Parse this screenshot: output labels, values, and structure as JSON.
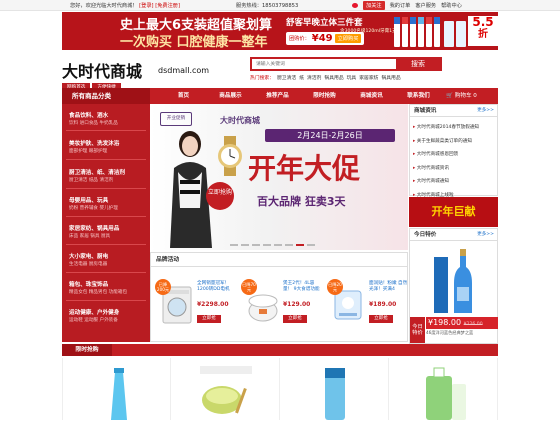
{
  "topbar": {
    "welcome": "您好，欢迎光临大时代商城！",
    "login": "[登录]",
    "register": "[免费注册]",
    "hotline_label": "服务热线：",
    "hotline": "18503798853",
    "weibo": "加关注",
    "links": [
      "我的订单",
      "客户服务",
      "帮助中心"
    ]
  },
  "banner": {
    "line1": "史上最大6支装超值聚划算",
    "line2": "一次购买 口腔健康一整年",
    "right_title": "舒客早晚立体三件套",
    "right_sub": "含3000名级120ml牙膏1支",
    "group_label": "团购价：",
    "group_price": "¥49",
    "group_btn": "立即购买",
    "discount_num": "5.5",
    "discount_unit": "折"
  },
  "logo": {
    "title": "大时代商城",
    "tags": [
      "网购首选",
      "方便快捷"
    ],
    "domain": "dsdmall.com"
  },
  "search": {
    "placeholder": "请输入关键词",
    "button": "搜索",
    "hot_label": "热门搜索：",
    "hot": [
      "厨卫清洁",
      "纸",
      "清洁剂",
      "锅具用品",
      "玩具",
      "家居家纺",
      "锅具用品"
    ]
  },
  "nav": {
    "all_categories": "所有商品分类",
    "items": [
      "首页",
      "商品展示",
      "推荐产品",
      "限时抢购",
      "商城资讯",
      "联系我们"
    ],
    "cart": "购物车 0"
  },
  "sidebar": [
    {
      "title": "食品饮料、酒水",
      "sub": "饮料  进口食品  牛奶乳品"
    },
    {
      "title": "美妆护肤、洗发沐浴",
      "sub": "面部护理  眼部护理"
    },
    {
      "title": "厨卫清洁、纸、清洁剂",
      "sub": "厨卫清洁  纸品  清洁剂"
    },
    {
      "title": "母婴用品、玩具",
      "sub": "奶粉  营养辅食  婴儿护理"
    },
    {
      "title": "家居家纺、锅具用品",
      "sub": "床品  家居  锅具  厨具"
    },
    {
      "title": "大小家电、厨电",
      "sub": "生活电器  厨房电器"
    },
    {
      "title": "箱包、珠宝饰品",
      "sub": "精品女包  精品男包  功能箱包"
    },
    {
      "title": "运动健康、户外健身",
      "sub": "运动鞋  运动服  户外装备"
    }
  ],
  "slider": {
    "brand_logo": "开业促销",
    "shop": "大时代商城",
    "dates": "2月24日-2月26日",
    "headline": "开年大促",
    "subline": "百大品牌 狂卖3天",
    "badge": "立即抢购"
  },
  "news": {
    "title": "商城资讯",
    "more": "更多>>",
    "items": [
      "大时代商城2014春节放假通知",
      "关于生鲜蔬菜类订单的通知",
      "大时代商城感恩回馈",
      "大时代商城资讯",
      "大时代商城通知",
      "大时代商城上线啦"
    ]
  },
  "promo_banner": "开年巨献",
  "today": {
    "title": "今日特价",
    "more": "更多>>",
    "tejia": "今日特价",
    "price": "¥198.00",
    "old_price": "¥226.00",
    "name": "46度洋河蓝色经典梦之蓝"
  },
  "brand": {
    "title": "品牌活动",
    "items": [
      {
        "tag": "已降200元",
        "name": "全网销量冠军！1200转DD电机",
        "price": "¥2298.00",
        "buy": "立即抢"
      },
      {
        "tag": "已降70元",
        "name": "煲王2代！4L容量！ 9大食谱功能",
        "price": "¥129.00",
        "buy": "立即抢"
      },
      {
        "tag": "已降20元",
        "name": "面润贴！粉嫩 自然光泽！买满4",
        "price": "¥189.00",
        "buy": "立即抢"
      }
    ]
  },
  "flash": {
    "title": "限时抢购"
  },
  "colors": {
    "brand_red": "#c21e23",
    "dark_red": "#9f1116"
  }
}
